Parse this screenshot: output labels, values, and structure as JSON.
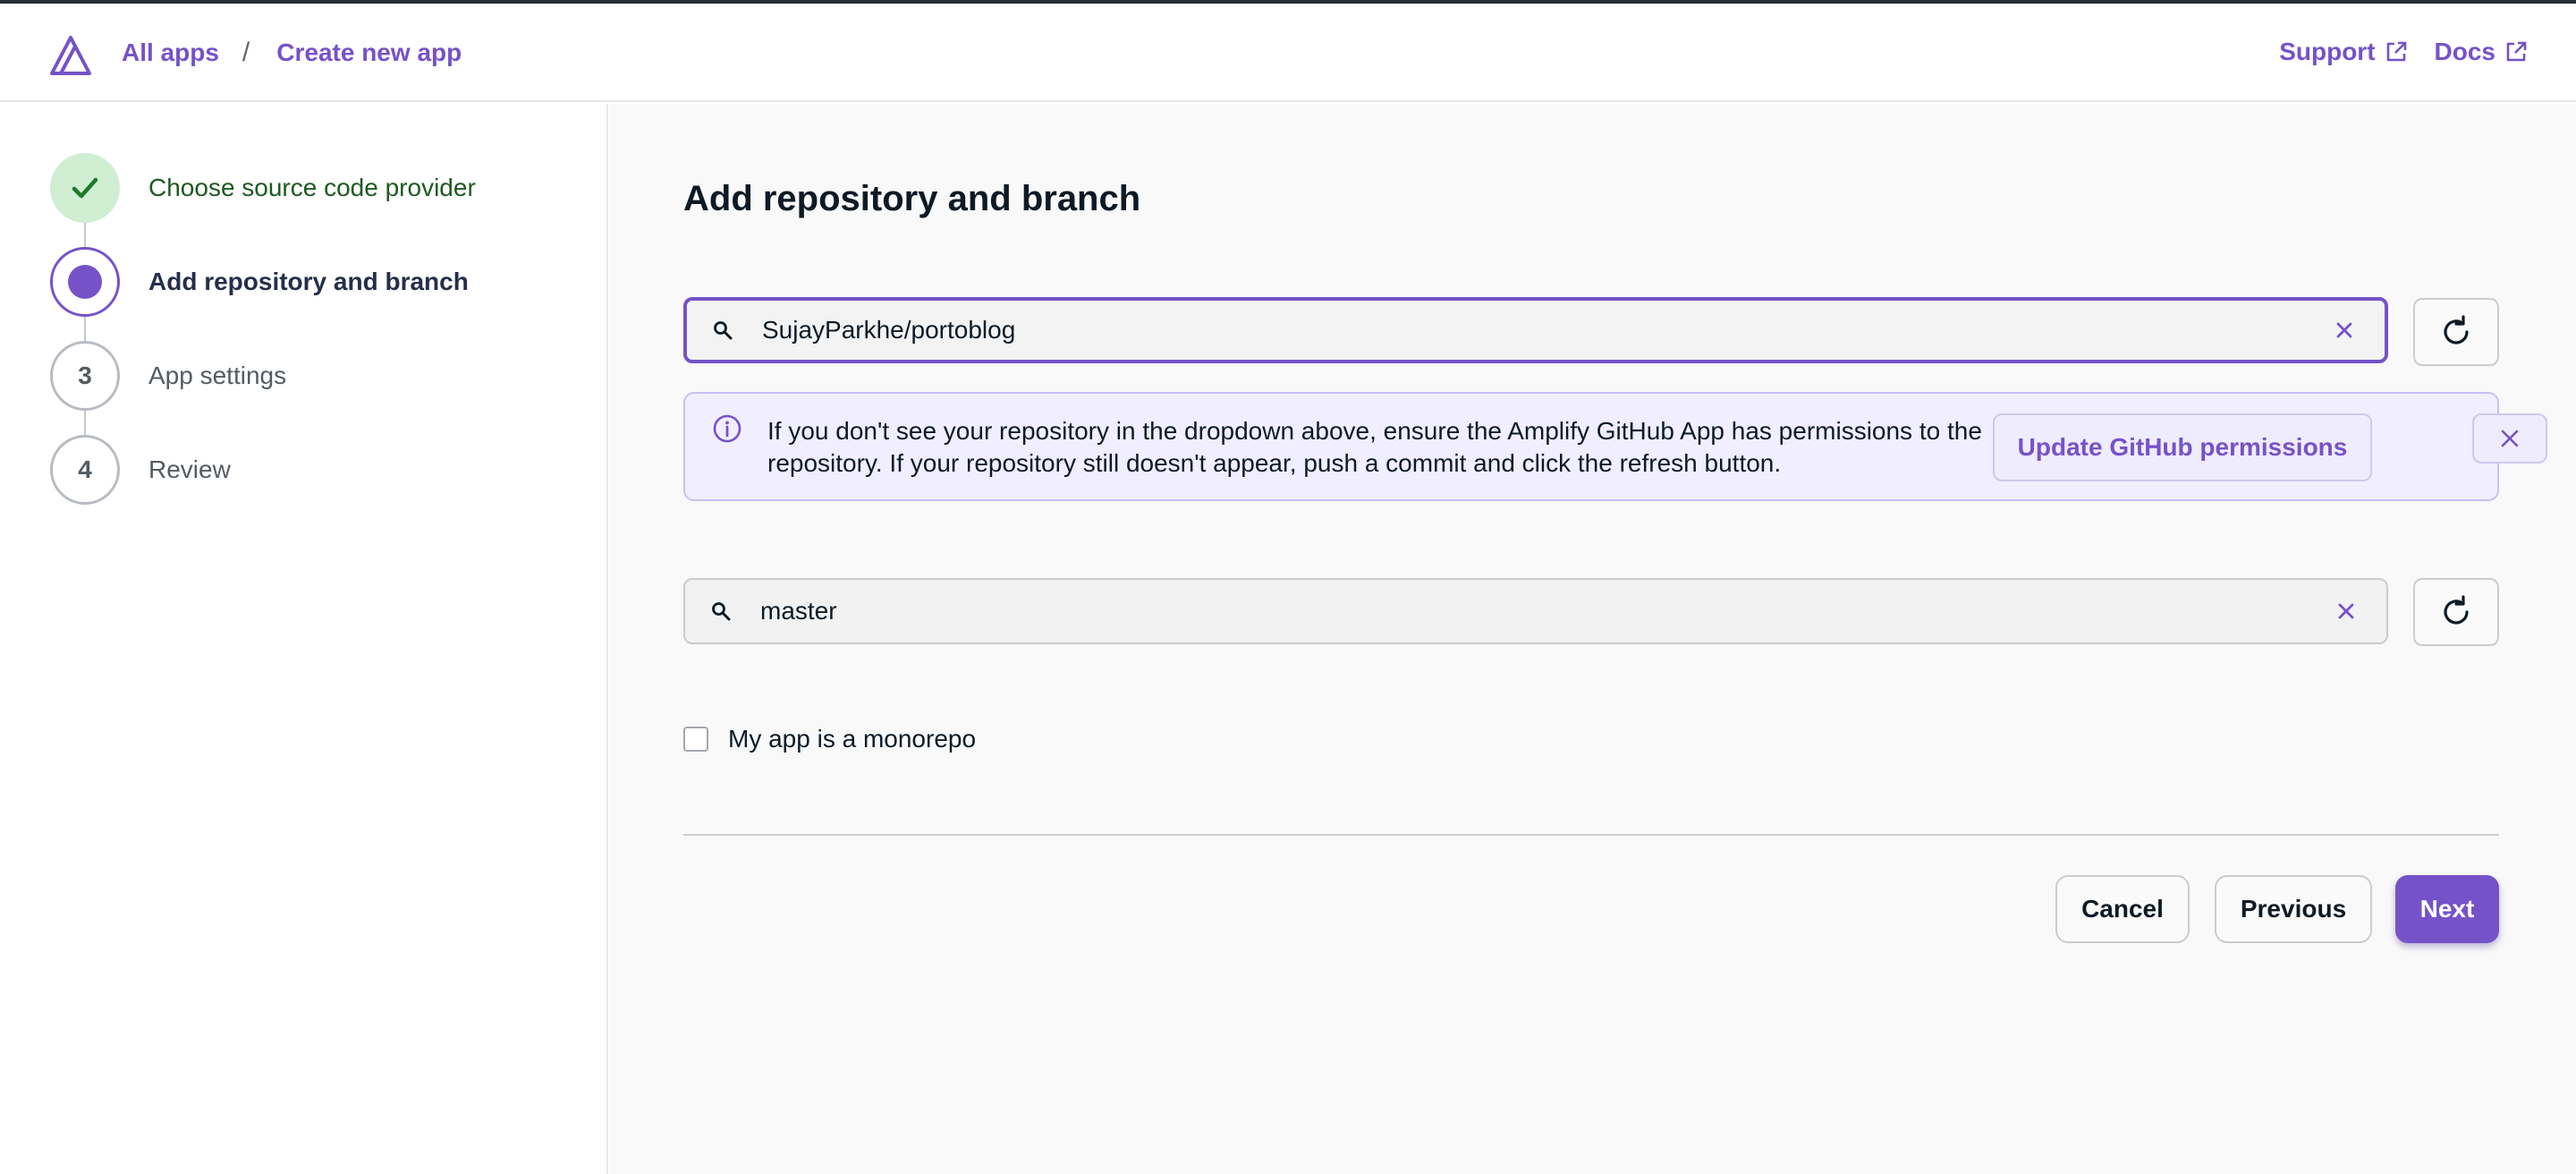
{
  "header": {
    "breadcrumbs": [
      "All apps",
      "Create new app"
    ],
    "separator": "/",
    "links": [
      "Support",
      "Docs"
    ],
    "logo": "amplify-logo-icon",
    "external_icon": "external-link-icon"
  },
  "steps": [
    {
      "number": "",
      "label": "Choose source code provider",
      "state": "done",
      "icon": "check-icon"
    },
    {
      "number": "",
      "label": "Add repository and branch",
      "state": "current",
      "icon": "current-dot-icon"
    },
    {
      "number": "3",
      "label": "App settings",
      "state": "todo"
    },
    {
      "number": "4",
      "label": "Review",
      "state": "todo"
    }
  ],
  "main": {
    "title": "Add repository and branch",
    "repository": {
      "value": "SujayParkhe/portoblog",
      "icons": [
        "search-icon",
        "clear-icon",
        "refresh-icon"
      ]
    },
    "alert": {
      "message": "If you don't see your repository in the dropdown above, ensure the Amplify GitHub App has permissions to the repository. If your repository still doesn't appear, push a commit and click the refresh button.",
      "action": "Update GitHub permissions",
      "icon": "info-icon",
      "dismiss_icon": "close-icon"
    },
    "branch": {
      "value": "master"
    },
    "monorepo": {
      "label": "My app is a monorepo",
      "checked": false
    },
    "buttons": {
      "cancel": "Cancel",
      "previous": "Previous",
      "next": "Next"
    }
  },
  "colors": {
    "accent": "#7652c9",
    "done_bg": "#cfeed2",
    "done_text": "#1d5a21",
    "alert_bg": "#f1efff"
  }
}
